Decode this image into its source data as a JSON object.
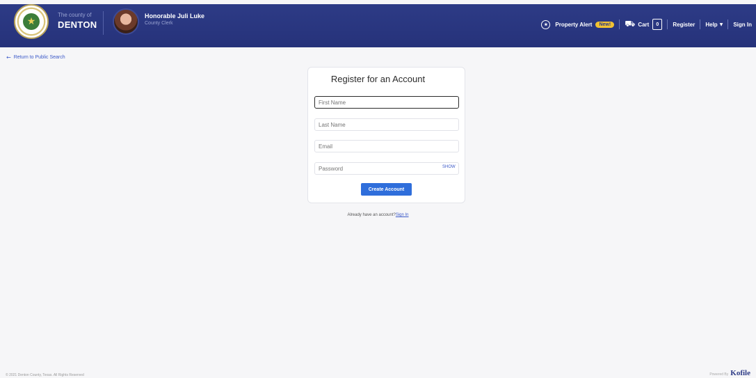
{
  "header": {
    "county_pre": "The county of",
    "county_name": "DENTON",
    "official_name": "Honorable Juli Luke",
    "official_title": "County Clerk",
    "nav": {
      "property_alert": "Property Alert",
      "new_badge": "New!",
      "cart": "Cart",
      "cart_count": "0",
      "register": "Register",
      "help": "Help",
      "sign_in": "Sign In"
    }
  },
  "back_link": "Return to Public Search",
  "form": {
    "title": "Register for an Account",
    "first_name_placeholder": "First Name",
    "last_name_placeholder": "Last Name",
    "email_placeholder": "Email",
    "password_placeholder": "Password",
    "show_label": "SHOW",
    "submit_label": "Create Account"
  },
  "signin_prompt": {
    "text": "Already have an account?",
    "link": "Sign In"
  },
  "footer": {
    "copyright": "© 2021 Denton County, Texas. All Rights Reserved",
    "powered_by": "Powered By",
    "brand": "Kofile"
  },
  "colors": {
    "header_bg": "#2d3b86",
    "accent": "#2f6edb",
    "badge": "#f2c232"
  }
}
